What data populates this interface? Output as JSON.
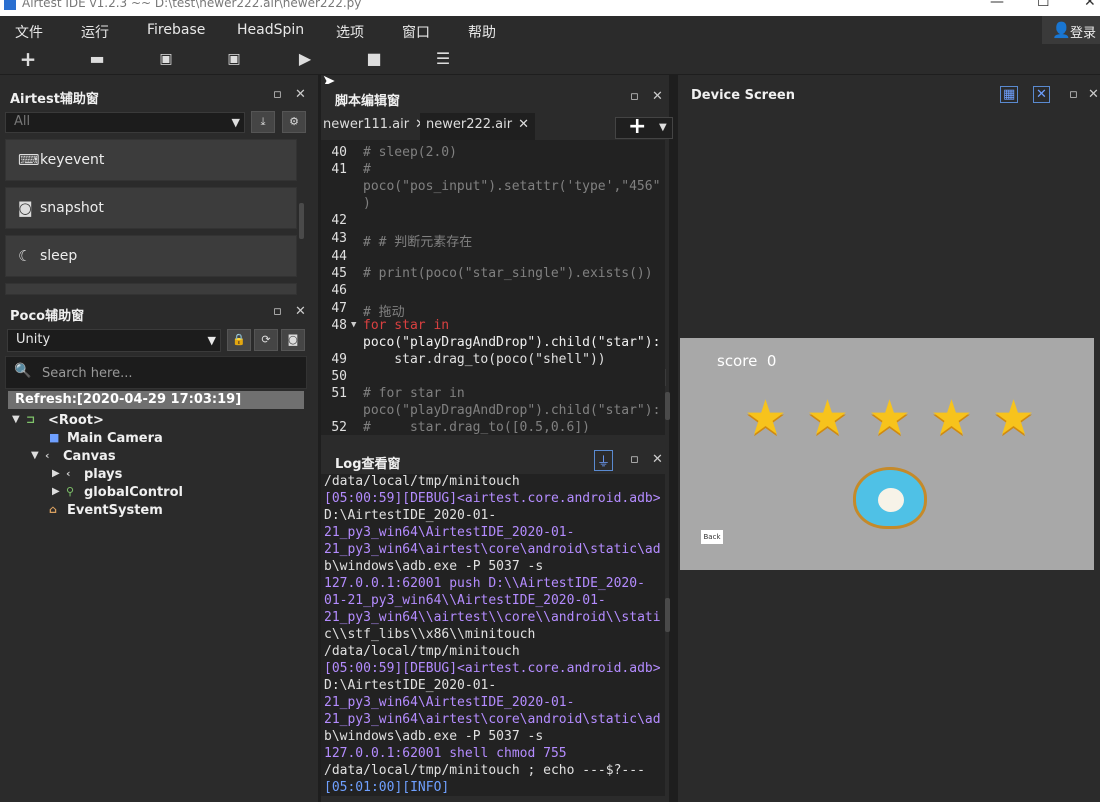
{
  "window": {
    "title": "Airtest IDE v1.2.3 ~~ D:\\test\\newer222.air\\newer222.py"
  },
  "menu": [
    "文件",
    "运行",
    "Firebase",
    "HeadSpin",
    "选项",
    "窗口",
    "帮助"
  ],
  "login_label": "登录",
  "toolbar": {
    "icons": [
      "new-file-icon",
      "open-folder-icon",
      "save-icon",
      "save-as-icon",
      "run-icon",
      "stop-icon",
      "log-icon"
    ]
  },
  "airtest_panel": {
    "title": "Airtest辅助窗",
    "filter_value": "All",
    "commands": [
      {
        "label": "keyevent",
        "icon": "keyboard-icon"
      },
      {
        "label": "snapshot",
        "icon": "camera-icon"
      },
      {
        "label": "sleep",
        "icon": "moon-icon"
      }
    ]
  },
  "poco_panel": {
    "title": "Poco辅助窗",
    "engine": "Unity",
    "search_placeholder": "Search here...",
    "refresh": "Refresh:[2020-04-29 17:03:19]",
    "tree": [
      {
        "label": "<Root>"
      },
      {
        "label": "Main Camera"
      },
      {
        "label": "Canvas"
      },
      {
        "label": "plays"
      },
      {
        "label": "globalControl"
      },
      {
        "label": "EventSystem"
      }
    ]
  },
  "editor": {
    "title": "脚本编辑窗",
    "tabs": [
      "newer111.air",
      "newer222.air"
    ],
    "lines": [
      {
        "n": "40",
        "text": "# sleep(2.0)"
      },
      {
        "n": "41",
        "text": "#"
      },
      {
        "n": "",
        "text": "poco(\"pos_input\").setattr('type',\"456\""
      },
      {
        "n": "",
        "text": ")"
      },
      {
        "n": "42",
        "text": ""
      },
      {
        "n": "43",
        "text": "# # 判断元素存在"
      },
      {
        "n": "44",
        "text": ""
      },
      {
        "n": "45",
        "text": "# print(poco(\"star_single\").exists())"
      },
      {
        "n": "46",
        "text": ""
      },
      {
        "n": "47",
        "text": "# 拖动"
      },
      {
        "n": "48",
        "text": "for star in"
      },
      {
        "n": "",
        "text": "poco(\"playDragAndDrop\").child(\"star\"):"
      },
      {
        "n": "49",
        "text": "    star.drag_to(poco(\"shell\"))"
      },
      {
        "n": "50",
        "text": ""
      },
      {
        "n": "51",
        "text": "# for star in"
      },
      {
        "n": "",
        "text": "poco(\"playDragAndDrop\").child(\"star\"):"
      },
      {
        "n": "52",
        "text": "#     star.drag_to([0.5,0.6])"
      }
    ]
  },
  "log": {
    "title": "Log查看窗",
    "lines": [
      "/data/local/tmp/minitouch",
      "[05:00:59][DEBUG]<airtest.core.android.adb>",
      "D:\\AirtestIDE_2020-01-",
      "21_py3_win64\\AirtestIDE_2020-01-",
      "21_py3_win64\\airtest\\core\\android\\static\\ad",
      "b\\windows\\adb.exe -P 5037 -s",
      "127.0.0.1:62001 push D:\\\\AirtestIDE_2020-",
      "01-21_py3_win64\\\\AirtestIDE_2020-01-",
      "21_py3_win64\\\\airtest\\\\core\\\\android\\\\stati",
      "c\\\\stf_libs\\\\x86\\\\minitouch",
      "/data/local/tmp/minitouch",
      "[05:00:59][DEBUG]<airtest.core.android.adb>",
      "D:\\AirtestIDE_2020-01-",
      "21_py3_win64\\AirtestIDE_2020-01-",
      "21_py3_win64\\airtest\\core\\android\\static\\ad",
      "b\\windows\\adb.exe -P 5037 -s",
      "127.0.0.1:62001 shell chmod 755",
      "/data/local/tmp/minitouch ; echo ---$?---",
      "[05:01:00][INFO]"
    ]
  },
  "device": {
    "title": "Device Screen",
    "score_label": "score",
    "score_value": "0",
    "stars": 5,
    "back_label": "Back"
  }
}
